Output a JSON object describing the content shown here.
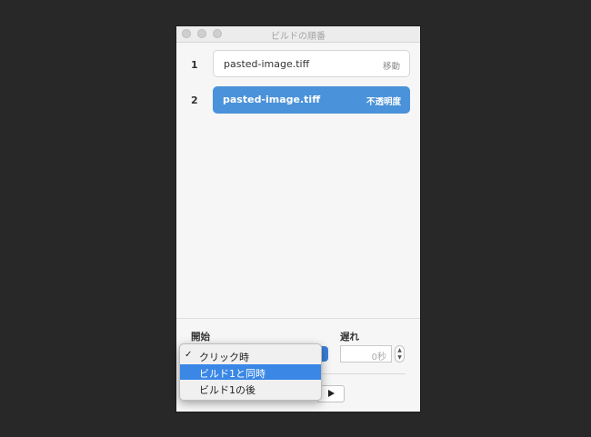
{
  "window": {
    "title": "ビルドの順番"
  },
  "builds": [
    {
      "number": "1",
      "name": "pasted-image.tiff",
      "effect": "移動",
      "selected": false
    },
    {
      "number": "2",
      "name": "pasted-image.tiff",
      "effect": "不透明度",
      "selected": true
    }
  ],
  "controls": {
    "start_label": "開始",
    "delay_label": "遅れ",
    "delay_value": "0秒"
  },
  "start_menu": {
    "options": [
      {
        "label": "クリック時",
        "checked": true,
        "highlighted": false
      },
      {
        "label": "ビルド1と同時",
        "checked": false,
        "highlighted": true
      },
      {
        "label": "ビルド1の後",
        "checked": false,
        "highlighted": false
      }
    ],
    "check_glyph": "✓"
  },
  "icons": {
    "play": "play-icon",
    "stepper_up": "▲",
    "stepper_down": "▼"
  },
  "colors": {
    "selected_item": "#4a92d9",
    "menu_highlight": "#3a87e6"
  }
}
